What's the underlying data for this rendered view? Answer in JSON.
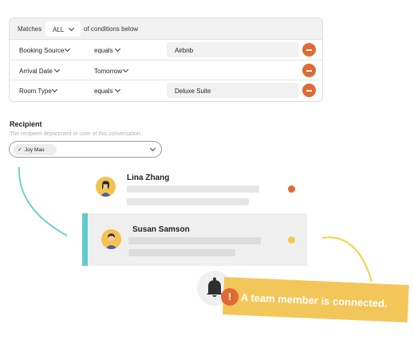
{
  "conditions": {
    "matches_label": "Matches",
    "match_value": "ALL",
    "suffix_label": "of conditions below",
    "rows": [
      {
        "field": "Booking Source",
        "operator": "equals",
        "value": "Airbnb"
      },
      {
        "field": "Arrival Date",
        "operator": "Tomorrow",
        "value": ""
      },
      {
        "field": "Room Type",
        "operator": "equals",
        "value": "Deluxe Suite"
      }
    ]
  },
  "recipient": {
    "title": "Recipient",
    "subtitle": "The recipient department or user of this conversation.",
    "selected_chip": "Joy Mao",
    "chip_check": "✓"
  },
  "cards": [
    {
      "name": "Lina Zhang",
      "status_color": "#e06a34"
    },
    {
      "name": "Susan Samson",
      "status_color": "#f1c94a"
    }
  ],
  "notification": {
    "badge": "!",
    "message": "A team member is connected."
  },
  "colors": {
    "accent_orange": "#e06a34",
    "accent_yellow": "#f3c65a",
    "accent_teal": "#5ecac9"
  }
}
